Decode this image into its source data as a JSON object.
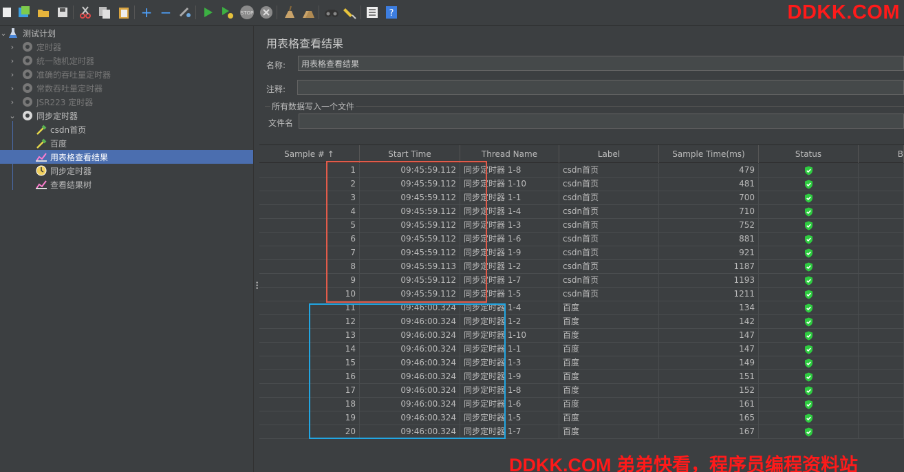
{
  "toolbar": {
    "brand": "DDKK.COM",
    "icons": [
      "new-icon",
      "templates-icon",
      "open-icon",
      "save-icon",
      "cut-icon",
      "copy-icon",
      "paste-icon",
      "expand-icon",
      "collapse-icon",
      "toggle-icon",
      "start-icon",
      "start-no-pause-icon",
      "stop-icon",
      "shutdown-icon",
      "clear-icon",
      "clear-all-icon",
      "search-icon",
      "reset-search-icon",
      "function-helper-icon",
      "help-icon"
    ]
  },
  "tree": {
    "root": "测试计划",
    "items": [
      {
        "label": "定时器",
        "disabled": true
      },
      {
        "label": "统一随机定时器",
        "disabled": true
      },
      {
        "label": "准确的吞吐量定时器",
        "disabled": true
      },
      {
        "label": "常数吞吐量定时器",
        "disabled": true
      },
      {
        "label": "JSR223 定时器",
        "disabled": true
      },
      {
        "label": "同步定时器",
        "disabled": false
      }
    ],
    "children": [
      {
        "label": "csdn首页"
      },
      {
        "label": "百度"
      },
      {
        "label": "用表格查看结果"
      },
      {
        "label": "同步定时器"
      },
      {
        "label": "查看结果树"
      }
    ]
  },
  "panel": {
    "title": "用表格查看结果",
    "name_label": "名称:",
    "name_value": "用表格查看结果",
    "comment_label": "注释:",
    "comment_value": "",
    "group_title": "所有数据写入一个文件",
    "filename_label": "文件名",
    "filename_value": ""
  },
  "table": {
    "columns": [
      "Sample # ↑",
      "Start Time",
      "Thread Name",
      "Label",
      "Sample Time(ms)",
      "Status",
      "B"
    ],
    "rows": [
      [
        "1",
        "09:45:59.112",
        "同步定时器 1-8",
        "csdn首页",
        "479"
      ],
      [
        "2",
        "09:45:59.112",
        "同步定时器 1-10",
        "csdn首页",
        "481"
      ],
      [
        "3",
        "09:45:59.112",
        "同步定时器 1-1",
        "csdn首页",
        "700"
      ],
      [
        "4",
        "09:45:59.112",
        "同步定时器 1-4",
        "csdn首页",
        "710"
      ],
      [
        "5",
        "09:45:59.112",
        "同步定时器 1-3",
        "csdn首页",
        "752"
      ],
      [
        "6",
        "09:45:59.112",
        "同步定时器 1-6",
        "csdn首页",
        "881"
      ],
      [
        "7",
        "09:45:59.112",
        "同步定时器 1-9",
        "csdn首页",
        "921"
      ],
      [
        "8",
        "09:45:59.113",
        "同步定时器 1-2",
        "csdn首页",
        "1187"
      ],
      [
        "9",
        "09:45:59.112",
        "同步定时器 1-7",
        "csdn首页",
        "1193"
      ],
      [
        "10",
        "09:45:59.112",
        "同步定时器 1-5",
        "csdn首页",
        "1211"
      ],
      [
        "11",
        "09:46:00.324",
        "同步定时器 1-4",
        "百度",
        "134"
      ],
      [
        "12",
        "09:46:00.324",
        "同步定时器 1-2",
        "百度",
        "142"
      ],
      [
        "13",
        "09:46:00.324",
        "同步定时器 1-10",
        "百度",
        "147"
      ],
      [
        "14",
        "09:46:00.324",
        "同步定时器 1-1",
        "百度",
        "147"
      ],
      [
        "15",
        "09:46:00.324",
        "同步定时器 1-3",
        "百度",
        "149"
      ],
      [
        "16",
        "09:46:00.324",
        "同步定时器 1-9",
        "百度",
        "151"
      ],
      [
        "17",
        "09:46:00.324",
        "同步定时器 1-8",
        "百度",
        "152"
      ],
      [
        "18",
        "09:46:00.324",
        "同步定时器 1-6",
        "百度",
        "161"
      ],
      [
        "19",
        "09:46:00.324",
        "同步定时器 1-5",
        "百度",
        "165"
      ],
      [
        "20",
        "09:46:00.324",
        "同步定时器 1-7",
        "百度",
        "167"
      ]
    ],
    "status_icon": "success-shield-icon"
  },
  "watermark": "DDKK.COM 弟弟快看，程序员编程资料站",
  "colors": {
    "background": "#3c3f41",
    "selection": "#4b6eaf",
    "highlight_red": "#e25b4a",
    "highlight_blue": "#22a6e2",
    "status_green": "#2ecc40",
    "brand_red": "#ff1a1a"
  }
}
